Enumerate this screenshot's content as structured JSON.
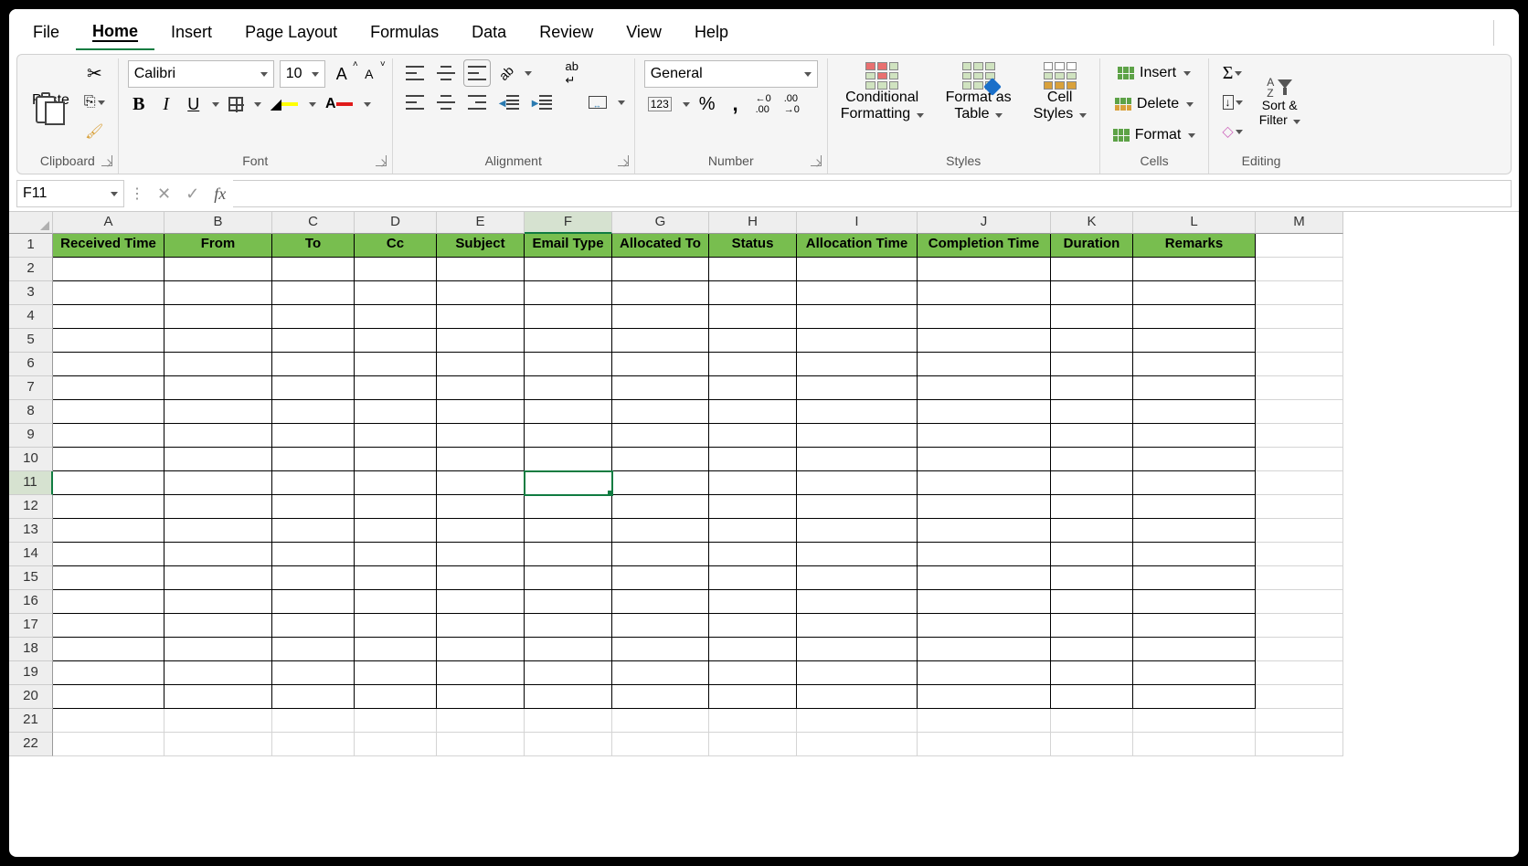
{
  "menu": {
    "file": "File",
    "home": "Home",
    "insert": "Insert",
    "page_layout": "Page Layout",
    "formulas": "Formulas",
    "data": "Data",
    "review": "Review",
    "view": "View",
    "help": "Help"
  },
  "ribbon": {
    "clipboard": {
      "paste": "Paste",
      "label": "Clipboard"
    },
    "font": {
      "name": "Calibri",
      "size": "10",
      "label": "Font"
    },
    "alignment": {
      "label": "Alignment"
    },
    "number": {
      "format": "General",
      "label": "Number"
    },
    "styles": {
      "cond1": "Conditional",
      "cond2": "Formatting",
      "fmt1": "Format as",
      "fmt2": "Table",
      "cell1": "Cell",
      "cell2": "Styles",
      "label": "Styles"
    },
    "cells": {
      "insert": "Insert",
      "delete": "Delete",
      "format": "Format",
      "label": "Cells"
    },
    "editing": {
      "sort1": "Sort &",
      "sort2": "Filter",
      "label": "Editing"
    }
  },
  "namebox": "F11",
  "formula": "",
  "columns": [
    "A",
    "B",
    "C",
    "D",
    "E",
    "F",
    "G",
    "H",
    "I",
    "J",
    "K",
    "L",
    "M"
  ],
  "col_widths": [
    "cw-A",
    "cw-B",
    "cw-C",
    "cw-D",
    "cw-E",
    "cw-F",
    "cw-G",
    "cw-H",
    "cw-I",
    "cw-J",
    "cw-K",
    "cw-L",
    "cw-M"
  ],
  "selected_col": "F",
  "selected_row": 11,
  "headers_row": [
    "Received Time",
    "From",
    "To",
    "Cc",
    "Subject",
    "Email Type",
    "Allocated To",
    "Status",
    "Allocation Time",
    "Completion Time",
    "Duration",
    "Remarks",
    ""
  ],
  "data_region_cols": 12,
  "total_cols": 13,
  "num_rows": 22
}
